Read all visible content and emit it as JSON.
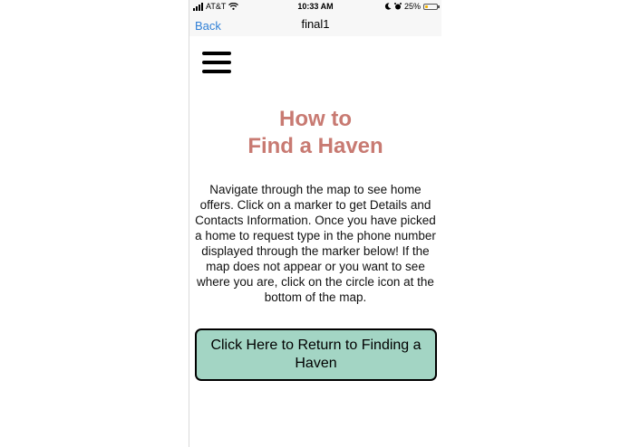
{
  "status_bar": {
    "carrier": "AT&T",
    "time": "10:33 AM",
    "battery_percent": "25%",
    "battery_level": 0.25,
    "icons": [
      "signal-icon",
      "wifi-icon",
      "moon-icon",
      "alarm-icon",
      "battery-icon"
    ]
  },
  "nav": {
    "back_label": "Back",
    "title": "final1"
  },
  "menu": {
    "icon": "hamburger-menu-icon"
  },
  "content": {
    "heading_line1": "How to",
    "heading_line2": "Find a Haven",
    "description": "Navigate through the map to see home offers. Click on a marker to get Details and Contacts Information. Once you have picked a home to request type in the phone number displayed through the marker below!  If the map does not appear or you want to see where you are, click on the circle icon at the bottom of the map.",
    "button_label": "Click Here to Return to Finding a Haven"
  },
  "colors": {
    "heading": "#c87a72",
    "button_bg": "#a3d5c4",
    "link": "#2f7fd6"
  }
}
